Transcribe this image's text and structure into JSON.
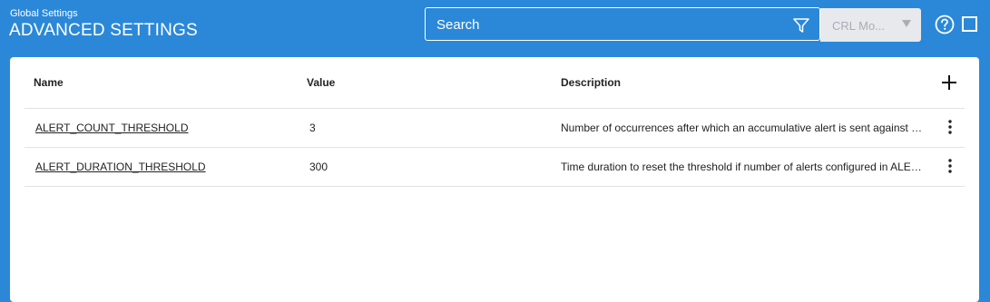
{
  "header": {
    "breadcrumb": "Global Settings",
    "title": "ADVANCED SETTINGS",
    "search": {
      "placeholder": "Search"
    },
    "dropdown": {
      "value": "CRL Mo..."
    },
    "icons": [
      "filter-icon",
      "help-icon",
      "window-icon"
    ]
  },
  "table": {
    "columns": {
      "name": "Name",
      "value": "Value",
      "description": "Description"
    },
    "rows": [
      {
        "name": "ALERT_COUNT_THRESHOLD",
        "value": "3",
        "description": "Number of occurrences after which an accumulative alert is sent against …"
      },
      {
        "name": "ALERT_DURATION_THRESHOLD",
        "value": "300",
        "description": "Time duration to reset the threshold if number of alerts configured in ALE…"
      }
    ]
  },
  "colors": {
    "header_bg": "#2b88d8",
    "panel_bg": "#ffffff",
    "dropdown_bg": "#e7e9ed"
  }
}
